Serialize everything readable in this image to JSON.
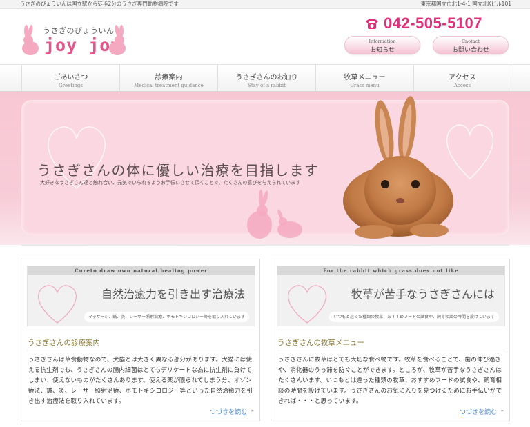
{
  "topbar": {
    "left_text": "うさぎのびょういんは国立駅から徒歩2分のうさぎ専門動物病院です",
    "right_text": "東京都国立市北1-4-1 国立北Kビル101"
  },
  "logo": {
    "tagline": "うさぎのびょういん",
    "brand": "joy joy"
  },
  "phone": {
    "icon": "phone-icon",
    "number": "042-505-5107"
  },
  "header_buttons": [
    {
      "en": "Information",
      "jp": "お知らせ"
    },
    {
      "en": "Cnotact",
      "jp": "お問い合わせ"
    }
  ],
  "nav": [
    {
      "jp": "ごあいさつ",
      "en": "Greetings"
    },
    {
      "jp": "診療案内",
      "en": "Medical treatment guidance"
    },
    {
      "jp": "うさぎさんのお泊り",
      "en": "Stay of a rabbit"
    },
    {
      "jp": "牧草メニュー",
      "en": "Grass menu"
    },
    {
      "jp": "アクセス",
      "en": "Access"
    }
  ],
  "hero": {
    "headline": "うさぎさんの体に優しい治療を目指します",
    "sub": "大好きなうさぎさん達と触れ合い、元気でいられるようお手伝いさせて頂くことで、たくさんの喜びを与えられています"
  },
  "boxes": [
    {
      "banner_en": "Cureto draw own natural healing power",
      "banner_title": "自然治癒力を引き出す治療法",
      "banner_desc": "マッサージ、鍼、灸、レーザー照射治療、ホモトキシコロジー等を取り入れています",
      "section_title": "うさぎさんの診療案内",
      "body": "うさぎさんは草食動物なので、犬猫とは大きく異なる部分があります。犬猫には使える抗生剤でも、うさぎさんの腸内細菌はとてもデリケートな為に抗生剤に負けてしまい、使えないものがたくさんあります。使える薬が限られてしまう分、オゾン療法、鍼、灸、レーザー照射治療、ホモトキシコロジー等といった自然治癒力を引き出す治療法を取り入れています。",
      "more": "つづきを読む"
    },
    {
      "banner_en": "For the rabbit which grass does not like",
      "banner_title": "牧草が苦手なうさぎさんには",
      "banner_desc": "いつもと違った種類の牧草、おすすめフードの試食や、飼育相談の時間を設けています",
      "section_title": "うさぎさんの牧草メニュー",
      "body": "うさぎさんに牧草はとても大切な食べ物です。牧草を食べることで、歯の伸び過ぎや、消化器のうっ滞を防ぐことができます。ところが、牧草が苦手なうさぎさんはたくさんいます。いつもとは違った種類の牧草、おすすめフードの試食や、飼育相談の時間を設けています。うさぎさんのお気に入りを見つけるためにお手伝いができれば・・・と思っています。",
      "more": "つづきを読む"
    }
  ],
  "colors": {
    "accent_pink": "#e0307a",
    "hero_pink": "#fbd8e1",
    "link_blue": "#4a86c8"
  }
}
